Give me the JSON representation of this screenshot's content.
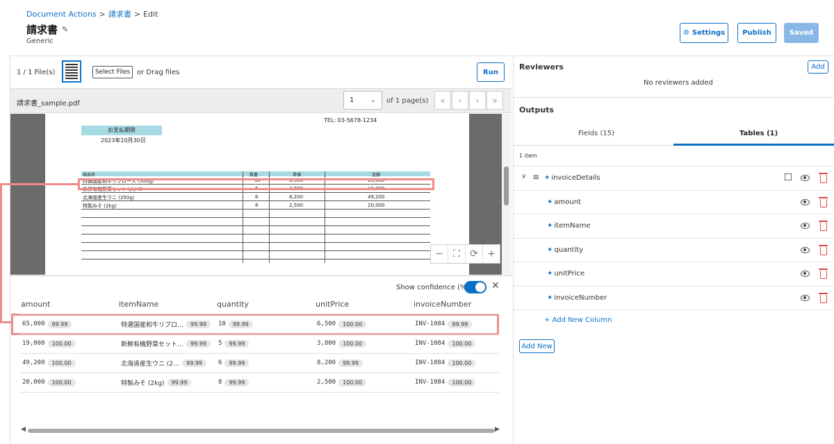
{
  "header": {
    "breadcrumb": {
      "root": "Document Actions",
      "parent": "請求書",
      "current": "Edit"
    },
    "title": "請求書",
    "subtitle": "Generic",
    "buttons": {
      "settings": "Settings",
      "publish": "Publish",
      "saved": "Saved"
    }
  },
  "toolbar": {
    "files_count": "1 / 1 File(s)",
    "select_files": "Select Files",
    "drag_label": "or Drag files",
    "run": "Run"
  },
  "pager": {
    "file_name": "請求書_sample.pdf",
    "page_value": "1",
    "page_of": "of 1 page(s)"
  },
  "document": {
    "tel": "TEL: 03-5678-1234",
    "payment_label": "お支払期限",
    "payment_date": "2023年10月30日",
    "col_headers": [
      "商品名",
      "数量",
      "単価",
      "金額"
    ],
    "rows": [
      {
        "item": "特選国産和牛リブロース (500g)",
        "qty": "10",
        "price": "6,500",
        "amount": "65,000"
      },
      {
        "item": "新鮮有機野菜セット (大) ☒",
        "qty": "5",
        "price": "3,800",
        "amount": "19,000"
      },
      {
        "item": "北海道産生ウニ (250g)",
        "qty": "6",
        "price": "8,200",
        "amount": "49,200"
      },
      {
        "item": "特製みそ (2kg)",
        "qty": "8",
        "price": "2,500",
        "amount": "20,000"
      }
    ]
  },
  "results": {
    "show_confidence": "Show confidence (%)",
    "columns": [
      "amount",
      "itemName",
      "quantity",
      "unitPrice",
      "invoiceNumber"
    ],
    "rows": [
      {
        "amount": "65,000",
        "amount_c": "99.99",
        "itemName": "特選国産和牛リブロ…",
        "itemName_c": "99.99",
        "quantity": "10",
        "quantity_c": "99.99",
        "unitPrice": "6,500",
        "unitPrice_c": "100.00",
        "invoiceNumber": "INV-1084",
        "invoiceNumber_c": "99.99"
      },
      {
        "amount": "19,000",
        "amount_c": "100.00",
        "itemName": "新鮮有機野菜セット…",
        "itemName_c": "99.99",
        "quantity": "5",
        "quantity_c": "99.99",
        "unitPrice": "3,800",
        "unitPrice_c": "100.00",
        "invoiceNumber": "INV-1084",
        "invoiceNumber_c": "100.00"
      },
      {
        "amount": "49,200",
        "amount_c": "100.00",
        "itemName": "北海道産生ウニ (2…",
        "itemName_c": "99.99",
        "quantity": "6",
        "quantity_c": "99.99",
        "unitPrice": "8,200",
        "unitPrice_c": "99.99",
        "invoiceNumber": "INV-1084",
        "invoiceNumber_c": "100.00"
      },
      {
        "amount": "20,000",
        "amount_c": "100.00",
        "itemName": "特製みそ (2kg)",
        "itemName_c": "99.99",
        "quantity": "8",
        "quantity_c": "99.99",
        "unitPrice": "2,500",
        "unitPrice_c": "100.00",
        "invoiceNumber": "INV-1084",
        "invoiceNumber_c": "100.00"
      }
    ]
  },
  "reviewers": {
    "title": "Reviewers",
    "add": "Add",
    "empty": "No reviewers added"
  },
  "outputs": {
    "title": "Outputs",
    "tabs": [
      "Fields (15)",
      "Tables (1)"
    ],
    "active_tab": "Tables (1)",
    "item_count": "1 item",
    "table_name": "invoiceDetails",
    "fields": [
      "amount",
      "itemName",
      "quantity",
      "unitPrice",
      "invoiceNumber"
    ],
    "add_column": "Add New Column",
    "add_new": "Add New"
  },
  "colors": {
    "accent": "#0b6fc6",
    "highlight": "#f08a8a",
    "doc_header": "#a7dbe3",
    "delete": "#dd4444"
  }
}
